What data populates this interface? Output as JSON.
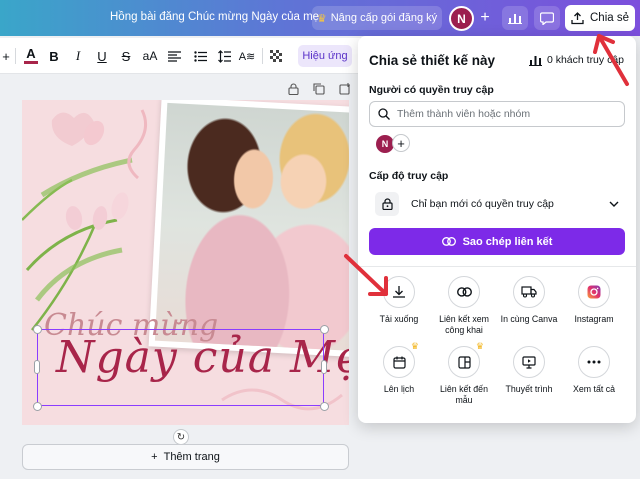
{
  "app": {
    "doc_title": "Hồng bài đăng Chúc mừng Ngày của mẹ",
    "upgrade_label": "Nâng cấp gói đăng ký",
    "avatar_initial": "N",
    "share_label": "Chia sẻ"
  },
  "toolbar": {
    "font_size_plus": "+",
    "case_label": "aA",
    "effects_label": "Hiệu ứng"
  },
  "canvas": {
    "script_line1": "Chúc mừng",
    "script_line2": "Ngày của Mẹ",
    "add_page_label": "Thêm trang"
  },
  "share_panel": {
    "title": "Chia sẻ thiết kế này",
    "viewers": "0 khách truy cập",
    "people_label": "Người có quyền truy cập",
    "search_placeholder": "Thêm thành viên hoặc nhóm",
    "member_initial": "N",
    "access_level_label": "Cấp độ truy cập",
    "access_value": "Chỉ bạn mới có quyền truy cập",
    "copy_link_label": "Sao chép liên kết",
    "options": [
      {
        "label": "Tải xuống",
        "icon": "download-icon",
        "crown": false
      },
      {
        "label": "Liên kết xem công khai",
        "icon": "link-icon",
        "crown": false
      },
      {
        "label": "In cùng Canva",
        "icon": "truck-icon",
        "crown": false
      },
      {
        "label": "Instagram",
        "icon": "instagram-icon",
        "crown": false
      },
      {
        "label": "Lên lịch",
        "icon": "calendar-icon",
        "crown": true
      },
      {
        "label": "Liên kết đến mẫu",
        "icon": "template-icon",
        "crown": true
      },
      {
        "label": "Thuyết trình",
        "icon": "present-icon",
        "crown": false
      },
      {
        "label": "Xem tất cả",
        "icon": "more-icon",
        "crown": false
      }
    ]
  },
  "colors": {
    "accent": "#7d2ae8",
    "annotation_arrow": "#e0303b",
    "avatar": "#9c1f4f"
  }
}
